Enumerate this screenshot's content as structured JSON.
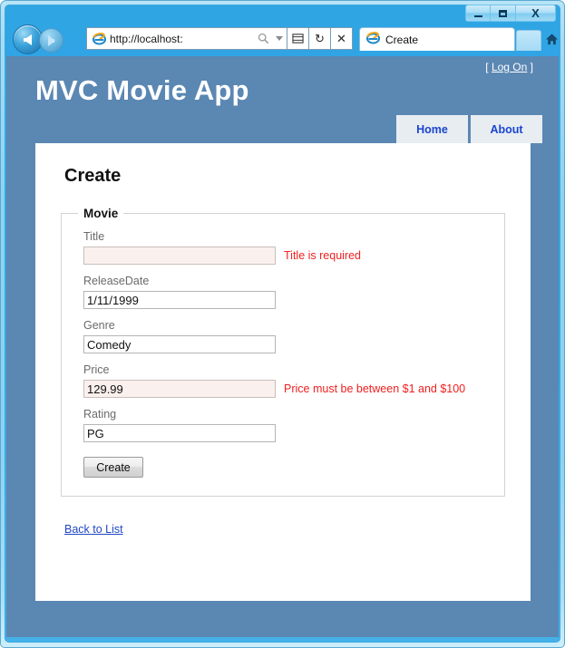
{
  "window": {
    "minimize_label": "Minimize",
    "maximize_label": "Maximize",
    "close_label": "X"
  },
  "browser": {
    "back_label": "Back",
    "forward_label": "Forward",
    "url": "http://localhost:",
    "search_icon": "search-icon",
    "dropdown_icon": "chevron-down-icon",
    "compat_label": "☰",
    "refresh_label": "↻",
    "stop_label": "✕",
    "tab_title": "Create",
    "new_tab_label": "",
    "home_icon": "home-icon",
    "favorites_icon": "star-icon",
    "settings_icon": "gear-icon"
  },
  "site": {
    "title": "MVC Movie App",
    "logon_prefix": "[ ",
    "logon_label": "Log On",
    "logon_suffix": " ]",
    "nav": [
      {
        "label": "Home"
      },
      {
        "label": "About"
      }
    ]
  },
  "page": {
    "heading": "Create",
    "fieldset_legend": "Movie",
    "fields": [
      {
        "label": "Title",
        "value": "",
        "error": "Title is required",
        "has_error": true
      },
      {
        "label": "ReleaseDate",
        "value": "1/11/1999",
        "error": "",
        "has_error": false
      },
      {
        "label": "Genre",
        "value": "Comedy",
        "error": "",
        "has_error": false
      },
      {
        "label": "Price",
        "value": "129.99",
        "error": "Price must be between $1 and $100",
        "has_error": true
      },
      {
        "label": "Rating",
        "value": "PG",
        "error": "",
        "has_error": false
      }
    ],
    "submit_label": "Create",
    "back_link_label": "Back to List"
  },
  "colors": {
    "page_background": "#5b87b3",
    "content_background": "#ffffff",
    "nav_tab_background": "#e8edf2",
    "nav_link": "#1a45cf",
    "error_text": "#f02020",
    "error_input_background": "#faf0ed",
    "link": "#2047c4"
  }
}
